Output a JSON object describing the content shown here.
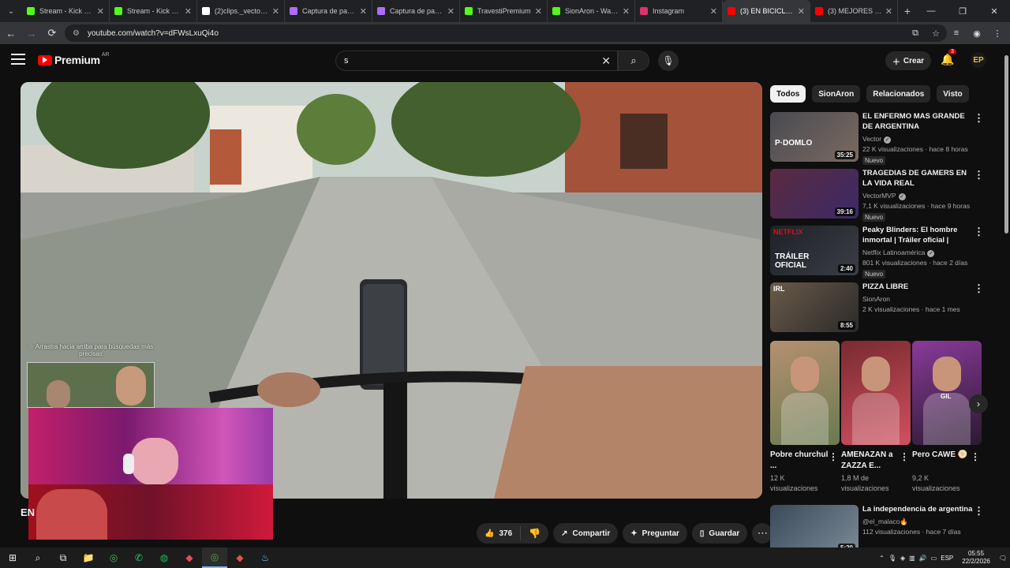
{
  "browser": {
    "tabs": [
      {
        "label": "Stream - Kick Dash",
        "icon": "kick-icon",
        "color": "#53fc18"
      },
      {
        "label": "Stream - Kick Dash",
        "icon": "kick-icon",
        "color": "#53fc18"
      },
      {
        "label": "(2)clips._vectorge",
        "icon": "tiktok-icon",
        "color": "#ffffff"
      },
      {
        "label": "Captura de pantalla",
        "icon": "screenshot-icon",
        "color": "#b06cff"
      },
      {
        "label": "Captura de pantalla",
        "icon": "screenshot-icon",
        "color": "#b06cff"
      },
      {
        "label": "TravestiPremium",
        "icon": "kick-icon",
        "color": "#53fc18"
      },
      {
        "label": "SionAron - Watch",
        "icon": "kick-icon",
        "color": "#53fc18"
      },
      {
        "label": "Instagram",
        "icon": "instagram-icon",
        "color": "#e1306c"
      },
      {
        "label": "(3) EN BICICLETA",
        "icon": "youtube-icon",
        "color": "#ff0000"
      },
      {
        "label": "(3) MEJORES MOMENT",
        "icon": "youtube-icon",
        "color": "#ff0000"
      }
    ],
    "url": "youtube.com/watch?v=dFWsLxuQi4o"
  },
  "header": {
    "brand": "Premium",
    "country": "AR",
    "search_value": "s",
    "create_label": "Crear",
    "notif_count": "3",
    "avatar_initials": "EP"
  },
  "player": {
    "hint_text": "☆ Arrastra hacia arriba para búsquedas más precisas",
    "progress": 0.0
  },
  "video": {
    "title_visible": "EN",
    "likes": "376",
    "share_label": "Compartir",
    "ask_label": "Preguntar",
    "save_label": "Guardar"
  },
  "chips": [
    "Todos",
    "SionAron",
    "Relacionados",
    "Visto"
  ],
  "recommendations": [
    {
      "title": "EL ENFERMO MAS GRANDE DE ARGENTINA",
      "channel": "Vector",
      "verified": true,
      "meta": "22 K visualizaciones · hace 8 horas",
      "badge": "Nuevo",
      "duration": "35:25",
      "thumb": [
        "#4a4a52",
        "#7a6a60"
      ],
      "thumb_text": "P·DOMLO"
    },
    {
      "title": "TRAGEDIAS DE GAMERS EN LA VIDA REAL",
      "channel": "VectorMVP",
      "verified": true,
      "meta": "7,1 K visualizaciones · hace 9 horas",
      "badge": "Nuevo",
      "duration": "39:16",
      "thumb": [
        "#5a2a40",
        "#3b2a66"
      ],
      "thumb_text": ""
    },
    {
      "title": "Peaky Blinders: El hombre inmortal | Tráiler oficial | Netflix",
      "channel": "Netflix Latinoamérica",
      "verified": true,
      "meta": "801 K visualizaciones · hace 2 días",
      "badge": "Nuevo",
      "duration": "2:40",
      "thumb": [
        "#1e2228",
        "#3a3e44"
      ],
      "thumb_text": "TRÁILER OFICIAL",
      "thumb_brand": "NETFLIX"
    },
    {
      "title": "PIZZA LIBRE",
      "channel": "SionAron",
      "verified": false,
      "meta": "2 K visualizaciones · hace 1 mes",
      "badge": "",
      "duration": "8:55",
      "thumb": [
        "#6a5a48",
        "#2a2a2a"
      ],
      "thumb_text": "",
      "thumb_brand": "IRL"
    },
    {
      "title": "La independencia de argentina",
      "channel": "@el_malaco🔥",
      "verified": false,
      "meta": "112 visualizaciones · hace 7 días",
      "badge": "",
      "duration": "5:20",
      "thumb": [
        "#3a4a5a",
        "#7a8a96"
      ],
      "thumb_text": ""
    }
  ],
  "shorts": [
    {
      "title": "Pobre churchul ...",
      "views_line1": "12 K",
      "views_line2": "visualizaciones",
      "colors": [
        "#b49070",
        "#6a7a50"
      ]
    },
    {
      "title": "AMENAZAN a ZAZZA E...",
      "views_line1": "1,8 M de",
      "views_line2": "visualizaciones",
      "colors": [
        "#7a2a30",
        "#d05060"
      ]
    },
    {
      "title": "Pero CAWE 🫓",
      "views_line1": "9,2 K",
      "views_line2": "visualizaciones",
      "colors": [
        "#8a3a9a",
        "#2a1a30"
      ],
      "overlay": "GIL"
    }
  ],
  "taskbar": {
    "lang": "ESP",
    "time": "05:55",
    "date": "22/2/2026",
    "apps": [
      "windows-icon",
      "search-icon",
      "taskview-icon",
      "explorer-icon",
      "chrome-icon",
      "whatsapp-icon",
      "spotify-icon",
      "app-icon",
      "chrome-icon",
      "app-icon",
      "steam-icon"
    ]
  }
}
